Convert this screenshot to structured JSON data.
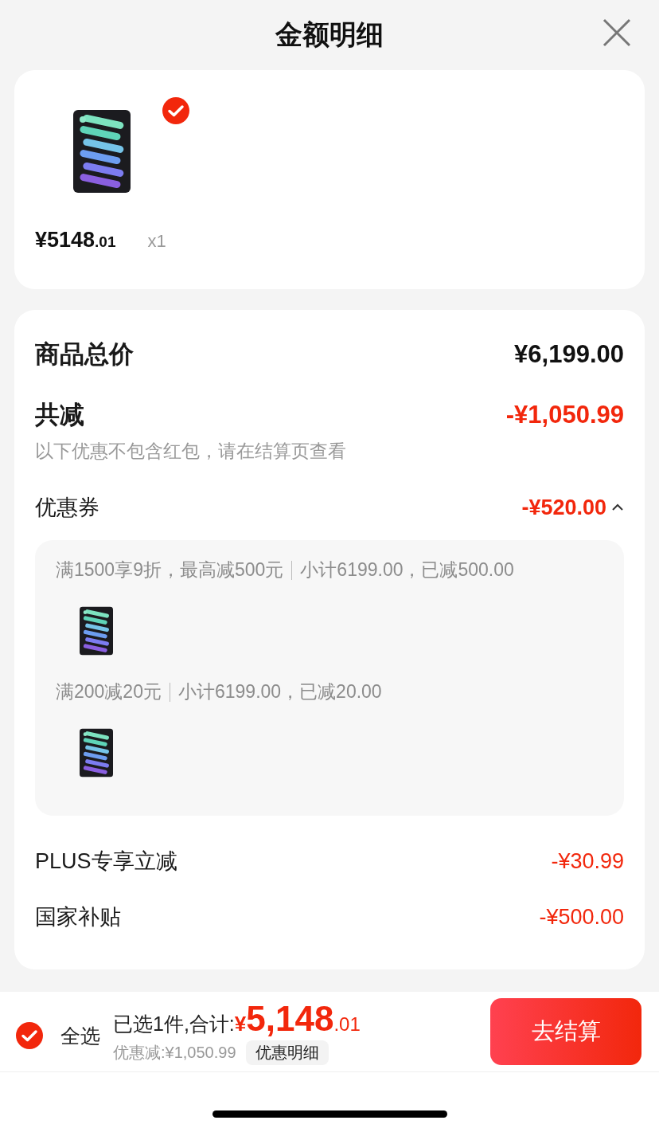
{
  "header": {
    "title": "金额明细"
  },
  "product": {
    "selected": true,
    "price_main": "¥5148",
    "price_decimal": ".01",
    "quantity": "x1"
  },
  "summary": [
    {
      "kind": "total",
      "label": "商品总价",
      "amount": "¥6,199.00"
    },
    {
      "kind": "major",
      "label": "共减",
      "amount": "-¥1,050.99",
      "note": "以下优惠不包含红包，请在结算页查看"
    },
    {
      "kind": "coupon",
      "label": "优惠券",
      "amount": "-¥520.00",
      "expanded": true,
      "groups": [
        {
          "rule": "满1500享9折，最高减500元",
          "subtotal": "小计6199.00，已减500.00"
        },
        {
          "rule": "满200减20元",
          "subtotal": "小计6199.00，已减20.00"
        }
      ]
    },
    {
      "kind": "minor",
      "label": "PLUS专享立减",
      "amount": "-¥30.99"
    },
    {
      "kind": "minor",
      "label": "国家补贴",
      "amount": "-¥500.00"
    }
  ],
  "bottom_bar": {
    "select_all": {
      "label": "全选",
      "checked": true
    },
    "selected_count": "已选1件,合计:",
    "total": {
      "currency": "¥",
      "main": "5,148",
      "decimal": ".01"
    },
    "discount": "优惠减:¥1,050.99",
    "details_button": "优惠明细",
    "checkout_button": "去结算"
  }
}
